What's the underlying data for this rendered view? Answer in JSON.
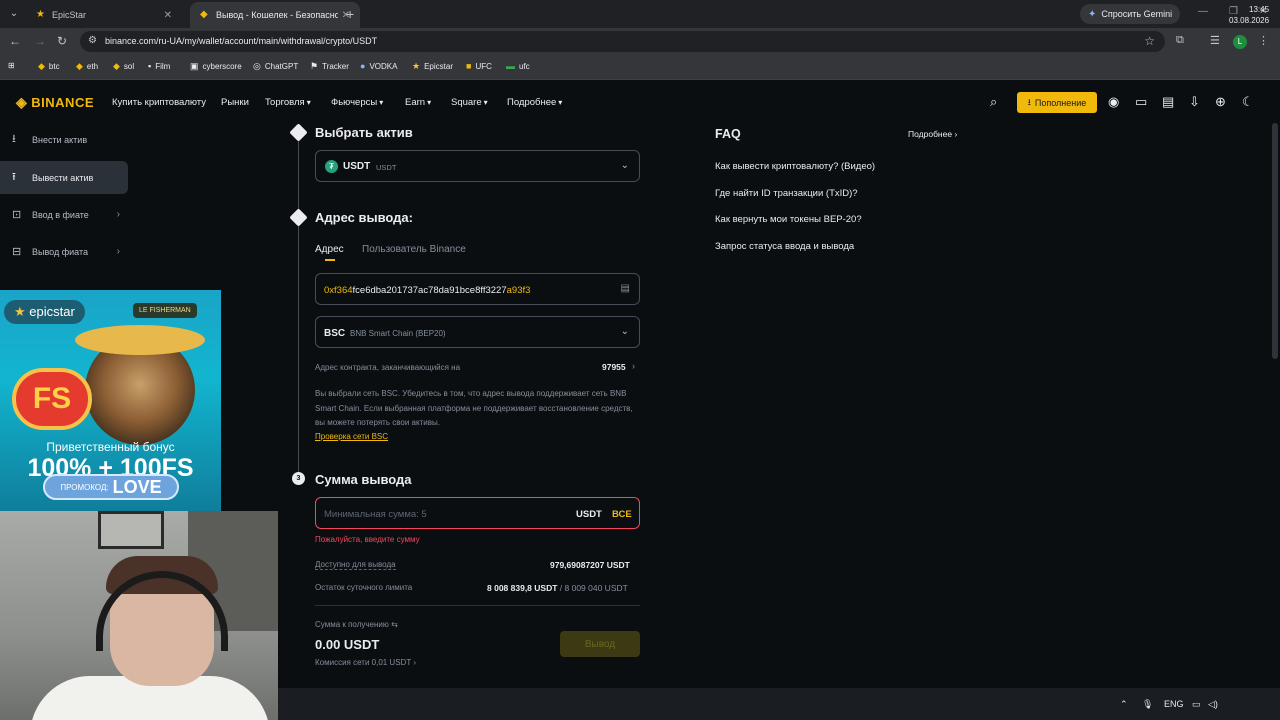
{
  "browser": {
    "tabs": [
      {
        "title": "EpicStar",
        "icon": "star-icon"
      },
      {
        "title": "Вывод - Кошелек - Безопасно",
        "icon": "binance-icon"
      }
    ],
    "gemini_label": "Спросить Gemini",
    "url": "binance.com/ru-UA/my/wallet/account/main/withdrawal/crypto/USDT",
    "profile_initial": "L",
    "bookmarks": [
      "btc",
      "eth",
      "sol",
      "Film",
      "cyberscore",
      "ChatGPT",
      "Tracker",
      "VODKA",
      "Epicstar",
      "UFC",
      "ufc"
    ]
  },
  "header": {
    "logo": "BINANCE",
    "menu": [
      "Купить криптовалюту",
      "Рынки",
      "Торговля",
      "Фьючерсы",
      "Earn",
      "Square",
      "Подробнее"
    ],
    "deposit_label": "Пополнение",
    "accent": "#f0b90b"
  },
  "sidebar": {
    "items": [
      {
        "label": "Внести актив",
        "icon": "download-icon"
      },
      {
        "label": "Вывести актив",
        "icon": "upload-icon"
      },
      {
        "label": "Ввод в фиате",
        "icon": "fiat-in-icon"
      },
      {
        "label": "Вывод фиата",
        "icon": "fiat-out-icon"
      }
    ]
  },
  "ad": {
    "brand": "epicstar",
    "game": "LE FISHERMAN",
    "badge": "FS",
    "bonus_line": "Приветственный бонус",
    "bonus_value": "100% + 100FS",
    "promo_label": "ПРОМОКОД:",
    "promo_code": "LOVE"
  },
  "withdraw": {
    "step1_title": "Выбрать актив",
    "asset": {
      "symbol": "USDT",
      "name": "USDT"
    },
    "step2_title": "Адрес вывода:",
    "addr_tabs": [
      "Адрес",
      "Пользователь Binance"
    ],
    "address_prefix": "0xf364",
    "address_middle": "fce6dba201737ac78da91bce8ff3227",
    "address_suffix": "a93f3",
    "network": {
      "code": "BSC",
      "name": "BNB Smart Chain (BEP20)"
    },
    "contract_label": "Адрес контракта, заканчивающийся на",
    "contract_value": "97955",
    "warning": "Вы выбрали сеть BSC. Убедитесь в том, что адрес вывода поддерживает сеть BNB Smart Chain. Если выбранная платформа не поддерживает восстановление средств, вы можете потерять свои активы.",
    "warning_link": "Проверка сети BSC",
    "step3_num": "3",
    "step3_title": "Сумма вывода",
    "amount_placeholder": "Минимальная сумма: 5",
    "amount_currency": "USDT",
    "amount_all": "ВСЕ",
    "error": "Пожалуйста, введите сумму",
    "available_label": "Доступно для вывода",
    "available_value": "979,69087207 USDT",
    "limit_label": "Остаток суточного лимита",
    "limit_used": "8 008 839,8 USDT",
    "limit_total": "/ 8 009 040 USDT",
    "receive_label": "Сумма к получению",
    "receive_value": "0.00 USDT",
    "fee_label": "Комиссия сети 0,01 USDT",
    "submit_label": "Вывод"
  },
  "faq": {
    "title": "FAQ",
    "more": "Подробнее",
    "items": [
      "Как вывести криптовалюту? (Видео)",
      "Где найти ID транзакции (TxID)?",
      "Как вернуть мои токены BEP-20?",
      "Запрос статуса ввода и вывода"
    ]
  },
  "taskbar": {
    "lang": "ENG",
    "time": "13:45",
    "date": "03.08.2026"
  }
}
